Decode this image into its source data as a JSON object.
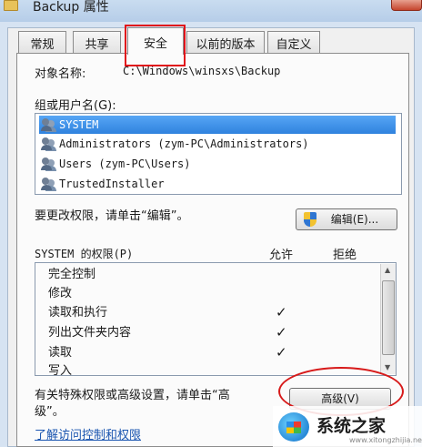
{
  "window": {
    "title": "Backup 属性"
  },
  "tabs": [
    {
      "label": "常规"
    },
    {
      "label": "共享"
    },
    {
      "label": "安全"
    },
    {
      "label": "以前的版本"
    },
    {
      "label": "自定义"
    }
  ],
  "security": {
    "object_label": "对象名称:",
    "object_path": "C:\\Windows\\winsxs\\Backup",
    "groups_label": "组或用户名(G):",
    "groups": [
      {
        "name": "SYSTEM"
      },
      {
        "name": "Administrators (zym-PC\\Administrators)"
      },
      {
        "name": "Users (zym-PC\\Users)"
      },
      {
        "name": "TrustedInstaller"
      }
    ],
    "edit_hint": "要更改权限，请单击“编辑”。",
    "edit_button": "编辑(E)...",
    "perm_title": "SYSTEM 的权限(P)",
    "allow_header": "允许",
    "deny_header": "拒绝",
    "permissions": [
      {
        "name": "完全控制",
        "allow": ""
      },
      {
        "name": "修改",
        "allow": ""
      },
      {
        "name": "读取和执行",
        "allow": "✓"
      },
      {
        "name": "列出文件夹内容",
        "allow": "✓"
      },
      {
        "name": "读取",
        "allow": "✓"
      },
      {
        "name": "写入",
        "allow": ""
      }
    ],
    "advanced_hint_line1": "有关特殊权限或高级设置，请单击“高",
    "advanced_hint_line2": "级”。",
    "advanced_button": "高级(V)",
    "learn_link": "了解访问控制和权限"
  },
  "watermark": {
    "text": "系统之家",
    "url": "www.xitongzhijia.net"
  },
  "colors": {
    "selection": "#3b8ee8",
    "highlight_red": "#e0131a",
    "link": "#1a55b0"
  }
}
